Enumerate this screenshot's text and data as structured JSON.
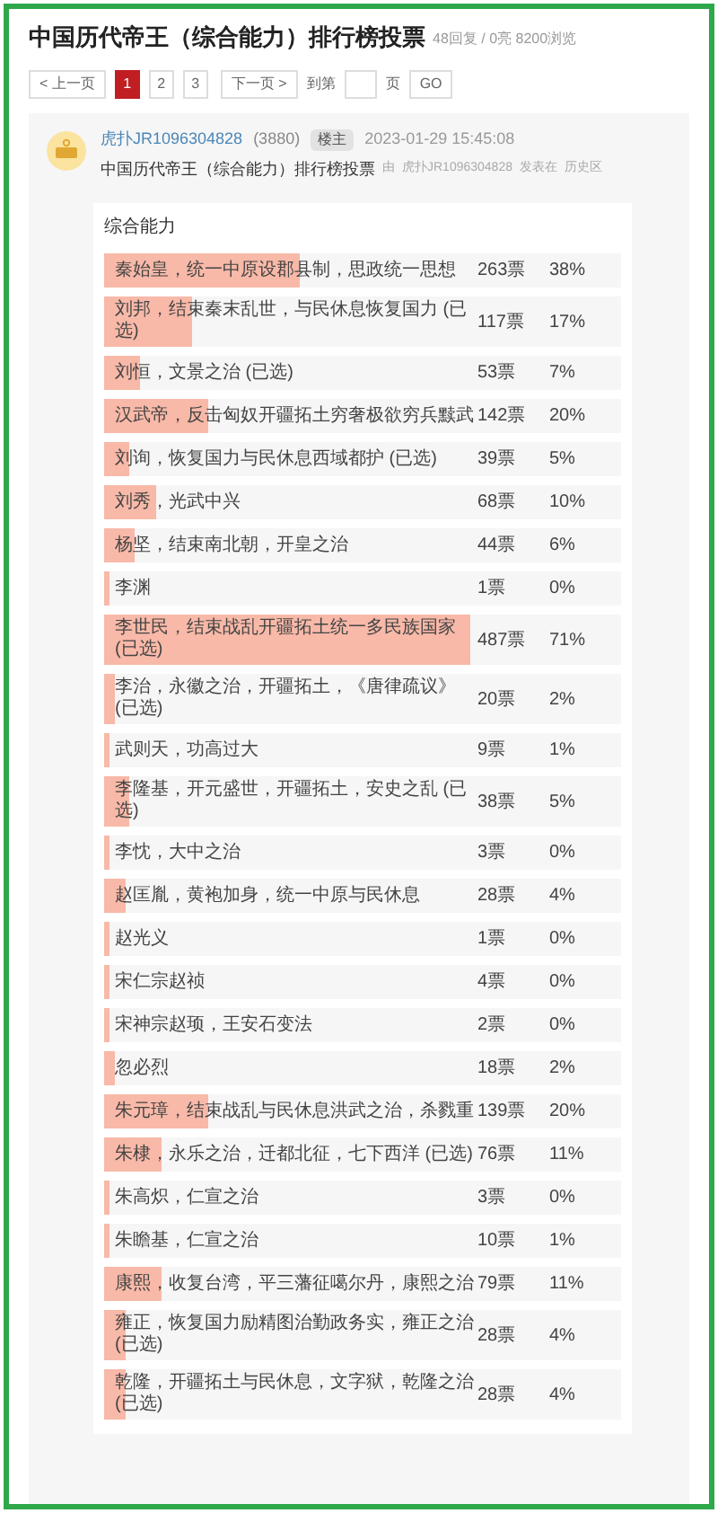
{
  "title": "中国历代帝王（综合能力）排行榜投票",
  "meta": "48回复 / 0亮 8200浏览",
  "pagination": {
    "prev": "< 上一页",
    "pages": [
      {
        "label": "1",
        "selected": true
      },
      {
        "label": "2",
        "selected": false
      },
      {
        "label": "3",
        "selected": false
      }
    ],
    "next": "下一页 >",
    "jump_label": "到第",
    "jump_unit": "页",
    "go": "GO"
  },
  "post": {
    "username": "虎扑JR1096304828",
    "count": "(3880)",
    "badge": "楼主",
    "time": "2023-01-29 15:45:08",
    "subject": "中国历代帝王（综合能力）排行榜投票",
    "by": "由",
    "author": "虎扑JR1096304828",
    "posted_in": "发表在",
    "board": "历史区"
  },
  "poll": {
    "heading": "综合能力",
    "options": [
      {
        "label": "秦始皇，统一中原设郡县制，思政统一思想",
        "votes": "263票",
        "percent": "38%",
        "level": 0.38
      },
      {
        "label": "刘邦，结束秦末乱世，与民休息恢复国力 (已选)",
        "votes": "117票",
        "percent": "17%",
        "level": 0.17
      },
      {
        "label": "刘恒，文景之治 (已选)",
        "votes": "53票",
        "percent": "7%",
        "level": 0.07
      },
      {
        "label": "汉武帝，反击匈奴开疆拓土穷奢极欲穷兵黩武",
        "votes": "142票",
        "percent": "20%",
        "level": 0.2
      },
      {
        "label": "刘询，恢复国力与民休息西域都护 (已选)",
        "votes": "39票",
        "percent": "5%",
        "level": 0.05
      },
      {
        "label": "刘秀，光武中兴",
        "votes": "68票",
        "percent": "10%",
        "level": 0.1
      },
      {
        "label": "杨坚，结束南北朝，开皇之治",
        "votes": "44票",
        "percent": "6%",
        "level": 0.06
      },
      {
        "label": "李渊",
        "votes": "1票",
        "percent": "0%",
        "level": 0
      },
      {
        "label": "李世民，结束战乱开疆拓土统一多民族国家 (已选)",
        "votes": "487票",
        "percent": "71%",
        "level": 0.71
      },
      {
        "label": "李治，永徽之治，开疆拓土，《唐律疏议》(已选)",
        "votes": "20票",
        "percent": "2%",
        "level": 0.02
      },
      {
        "label": "武则天，功高过大",
        "votes": "9票",
        "percent": "1%",
        "level": 0.01
      },
      {
        "label": "李隆基，开元盛世，开疆拓土，安史之乱 (已选)",
        "votes": "38票",
        "percent": "5%",
        "level": 0.05
      },
      {
        "label": "李忱，大中之治",
        "votes": "3票",
        "percent": "0%",
        "level": 0
      },
      {
        "label": "赵匡胤，黄袍加身，统一中原与民休息",
        "votes": "28票",
        "percent": "4%",
        "level": 0.04
      },
      {
        "label": "赵光义",
        "votes": "1票",
        "percent": "0%",
        "level": 0
      },
      {
        "label": "宋仁宗赵祯",
        "votes": "4票",
        "percent": "0%",
        "level": 0
      },
      {
        "label": "宋神宗赵顼，王安石变法",
        "votes": "2票",
        "percent": "0%",
        "level": 0
      },
      {
        "label": "忽必烈",
        "votes": "18票",
        "percent": "2%",
        "level": 0.02
      },
      {
        "label": "朱元璋，结束战乱与民休息洪武之治，杀戮重",
        "votes": "139票",
        "percent": "20%",
        "level": 0.2
      },
      {
        "label": "朱棣，永乐之治，迁都北征，七下西洋 (已选)",
        "votes": "76票",
        "percent": "11%",
        "level": 0.11
      },
      {
        "label": "朱高炽，仁宣之治",
        "votes": "3票",
        "percent": "0%",
        "level": 0
      },
      {
        "label": "朱瞻基，仁宣之治",
        "votes": "10票",
        "percent": "1%",
        "level": 0.01
      },
      {
        "label": "康熙，收复台湾，平三藩征噶尔丹，康熙之治",
        "votes": "79票",
        "percent": "11%",
        "level": 0.11
      },
      {
        "label": "雍正，恢复国力励精图治勤政务实，雍正之治 (已选)",
        "votes": "28票",
        "percent": "4%",
        "level": 0.04
      },
      {
        "label": "乾隆，开疆拓土与民休息，文字狱，乾隆之治 (已选)",
        "votes": "28票",
        "percent": "4%",
        "level": 0.04
      }
    ]
  }
}
